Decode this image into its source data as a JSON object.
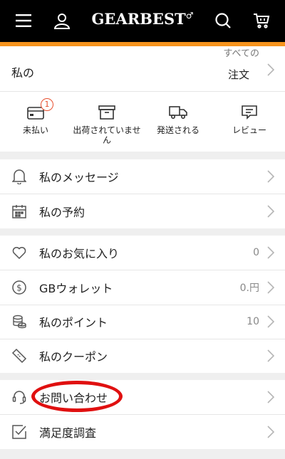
{
  "header": {
    "brand": "GEARBEST",
    "brand_mark": "♂",
    "icons": [
      "menu-icon",
      "user-icon",
      "search-icon",
      "cart-icon"
    ],
    "accent_color": "#f7941d"
  },
  "orders": {
    "title": "私の",
    "all_orders_line1": "すべての",
    "all_orders_line2": "注文",
    "items": [
      {
        "label": "未払い",
        "badge": "1",
        "icon": "card-icon"
      },
      {
        "label": "出荷されていません",
        "icon": "box-icon"
      },
      {
        "label": "発送される",
        "icon": "truck-icon"
      },
      {
        "label": "レビュー",
        "icon": "review-icon"
      }
    ]
  },
  "menu_group_1": [
    {
      "label": "私のメッセージ",
      "icon": "bell-icon"
    },
    {
      "label": "私の予約",
      "icon": "calendar-icon"
    }
  ],
  "menu_group_2": [
    {
      "label": "私のお気に入り",
      "value": "0",
      "icon": "heart-icon"
    },
    {
      "label": "GBウォレット",
      "value": "0.円",
      "icon": "dollar-icon"
    },
    {
      "label": "私のポイント",
      "value": "10",
      "icon": "coins-icon"
    },
    {
      "label": "私のクーポン",
      "value": "",
      "icon": "coupon-icon"
    }
  ],
  "menu_group_3": [
    {
      "label": "お問い合わせ",
      "icon": "headset-icon",
      "highlighted": true
    },
    {
      "label": "満足度調査",
      "icon": "checkbox-icon"
    }
  ],
  "highlight_color": "#e01010"
}
